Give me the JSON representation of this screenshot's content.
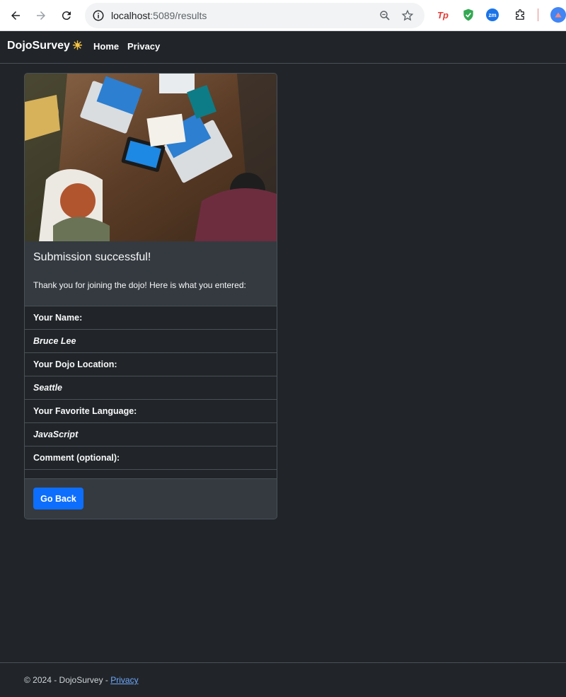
{
  "browser": {
    "url_host": "localhost",
    "url_path": ":5089/results",
    "extensions": [
      {
        "name": "tp-extension-icon",
        "label": "Tp",
        "color": "#e53935"
      },
      {
        "name": "shield-extension-icon",
        "label": "",
        "color": "#34a853"
      },
      {
        "name": "zm-extension-icon",
        "label": "zm",
        "color": "#1a73e8"
      }
    ]
  },
  "navbar": {
    "brand": "DojoSurvey",
    "brand_icon": "sun-icon",
    "links": [
      "Home",
      "Privacy"
    ]
  },
  "card": {
    "title": "Submission successful!",
    "text": "Thank you for joining the dojo! Here is what you entered:",
    "fields": [
      {
        "label": "Your Name:",
        "value": "Bruce Lee"
      },
      {
        "label": "Your Dojo Location:",
        "value": "Seattle"
      },
      {
        "label": "Your Favorite Language:",
        "value": "JavaScript"
      },
      {
        "label": "Comment (optional):",
        "value": ""
      }
    ],
    "button": "Go Back"
  },
  "footer": {
    "text": "© 2024 - DojoSurvey - ",
    "link": "Privacy"
  },
  "colors": {
    "background": "#212529",
    "primary": "#0d6efd",
    "link": "#6ea8fe"
  }
}
